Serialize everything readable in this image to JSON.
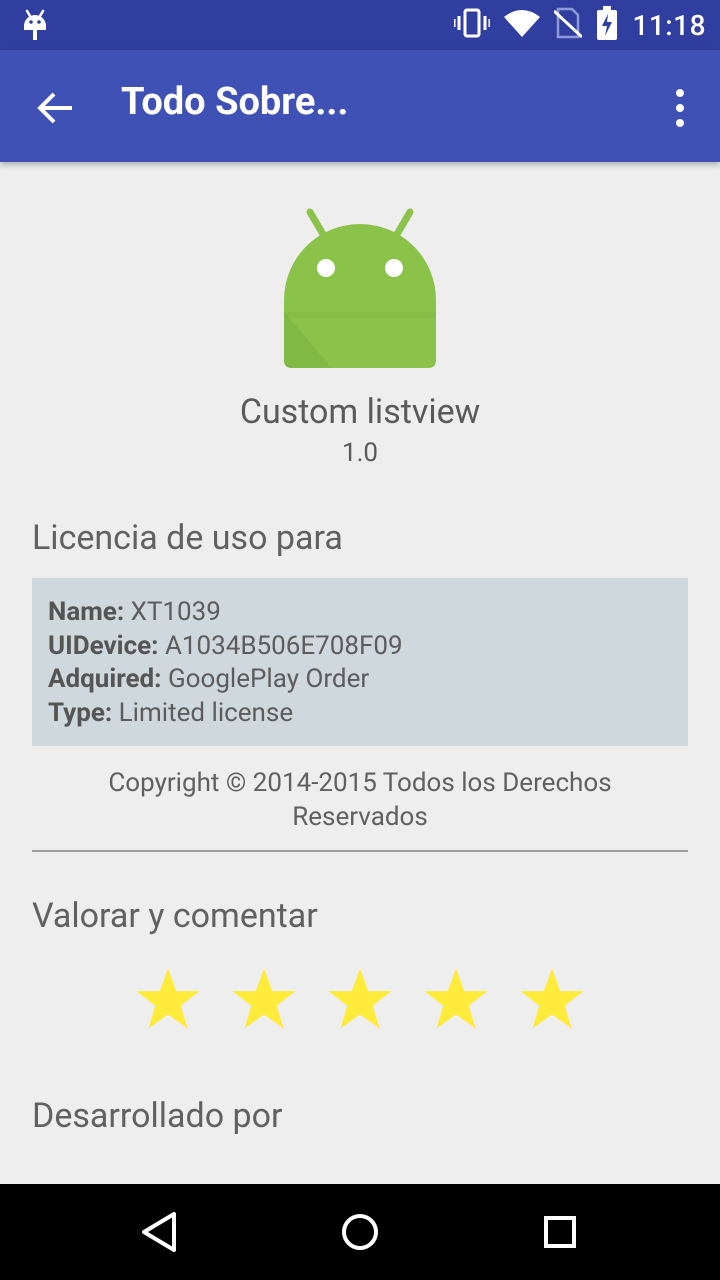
{
  "status_bar": {
    "time": "11:18",
    "icons": [
      "android-debug-icon",
      "vibrate-icon",
      "wifi-icon",
      "no-sim-icon",
      "battery-charging-icon"
    ]
  },
  "app_bar": {
    "title": "Todo Sobre...",
    "back_icon": "arrow-back-icon",
    "menu_icon": "more-vert-icon"
  },
  "app_info": {
    "name": "Custom listview",
    "version": "1.0",
    "icon": "android-robot-icon"
  },
  "license": {
    "heading": "Licencia de uso para",
    "rows": [
      {
        "label": "Name:",
        "value": "XT1039"
      },
      {
        "label": "UIDevice:",
        "value": "A1034B506E708F09"
      },
      {
        "label": "Adquired:",
        "value": "GooglePlay Order"
      },
      {
        "label": "Type:",
        "value": "Limited license"
      }
    ]
  },
  "copyright": "Copyright © 2014-2015 Todos los Derechos Reservados",
  "rating": {
    "heading": "Valorar y comentar",
    "stars": 5,
    "star_color": "#FFEB3B"
  },
  "developer": {
    "heading": "Desarrollado por"
  },
  "nav_bar": {
    "buttons": [
      "back-triangle-icon",
      "home-circle-icon",
      "recents-square-icon"
    ]
  },
  "colors": {
    "primary": "#3F51B5",
    "primary_dark": "#303F9F",
    "license_bg": "#CFD8DC",
    "background": "#EEEEEE"
  }
}
